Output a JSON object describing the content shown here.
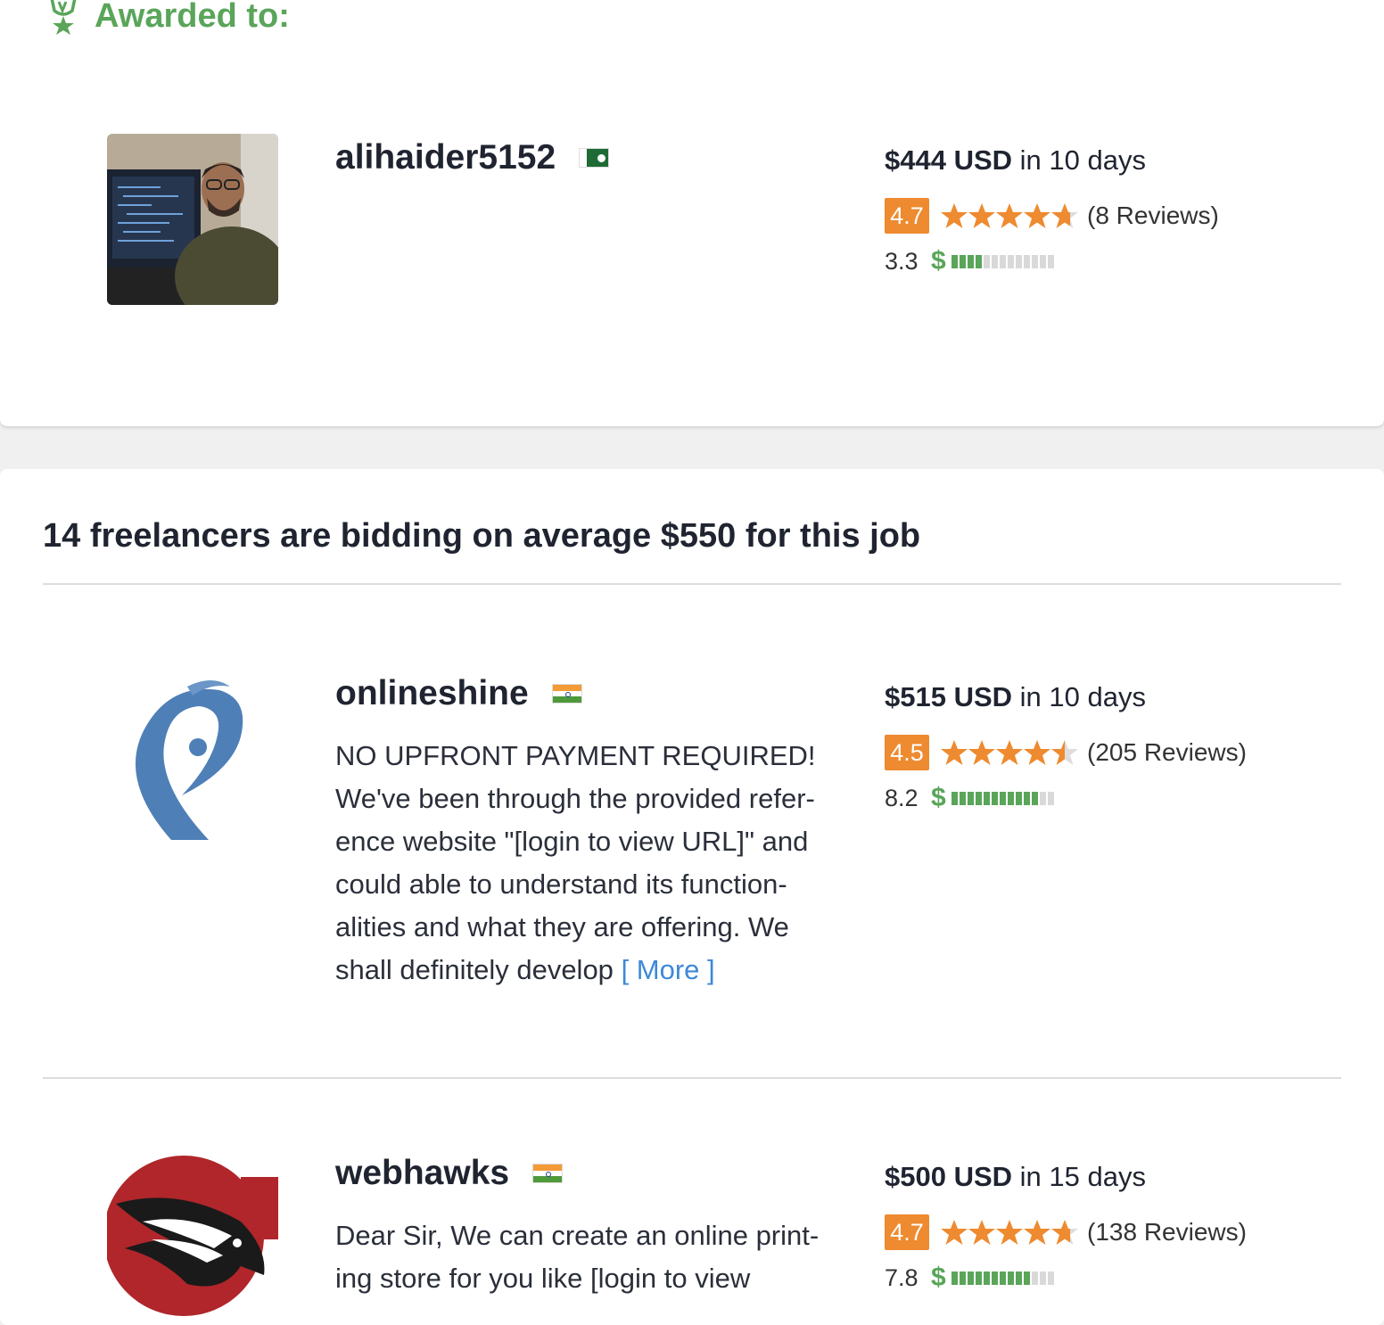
{
  "awarded": {
    "header": "Awarded to:",
    "freelancer": {
      "username": "alihaider5152",
      "flag": "pakistan-flag",
      "price_amount": "$444 USD",
      "price_period": "in 10 days",
      "rating": "4.7",
      "stars": 4.7,
      "reviews": "(8 Reviews)",
      "earnings_score": "3.3",
      "earnings_fill": 0.33
    }
  },
  "bids": {
    "title": "14 freelancers are bidding on average $550 for this job",
    "items": [
      {
        "username": "onlineshine",
        "flag": "india-flag",
        "price_amount": "$515 USD",
        "price_period": "in 10 days",
        "rating": "4.5",
        "stars": 4.5,
        "reviews": "(205 Reviews)",
        "earnings_score": "8.2",
        "earnings_fill": 0.82,
        "description_lines": [
          "NO UPFRONT PAYMENT REQUIRED!",
          "We've been through the provided refer-",
          "ence website \"[login to view URL]\" and",
          "could able to understand its function-",
          "alities and what they are offering. We",
          "shall definitely develop"
        ],
        "more_label": "[ More ]"
      },
      {
        "username": "webhawks",
        "flag": "india-flag",
        "price_amount": "$500 USD",
        "price_period": "in 15 days",
        "rating": "4.7",
        "stars": 4.7,
        "reviews": "(138 Reviews)",
        "earnings_score": "7.8",
        "earnings_fill": 0.78,
        "description_lines": [
          "Dear Sir, We can create an online print-",
          "ing store for you like [login to view"
        ]
      }
    ]
  },
  "colors": {
    "accent_green": "#5aa55a",
    "rating_orange": "#ee8a2f",
    "link_blue": "#3d89d6"
  }
}
